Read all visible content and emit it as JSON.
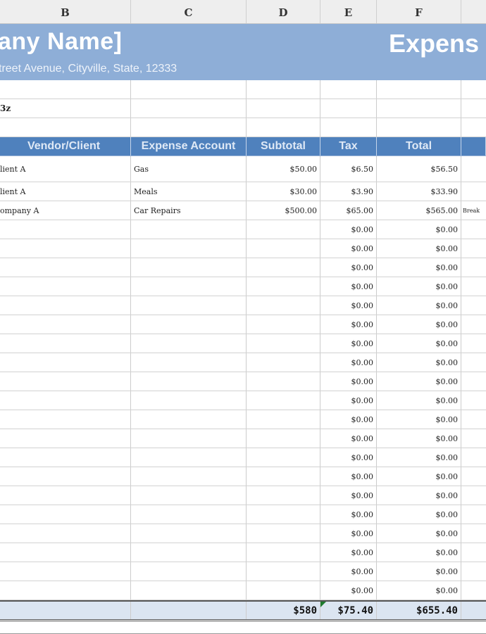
{
  "column_headers": [
    "B",
    "C",
    "D",
    "E",
    "F"
  ],
  "header_band": {
    "company_name": "any Name]",
    "address": "treet Avenue, Cityville, State, 12333",
    "document_title": "Expens"
  },
  "info_rows": {
    "row2_b": "3z"
  },
  "table": {
    "columns": [
      "Vendor/Client",
      "Expense Account",
      "Subtotal",
      "Tax",
      "Total",
      ""
    ],
    "rows": [
      {
        "vendor": "lient A",
        "account": "Gas",
        "subtotal": "$50.00",
        "tax": "$6.50",
        "total": "$56.50",
        "note": ""
      },
      {
        "vendor": "lient A",
        "account": "Meals",
        "subtotal": "$30.00",
        "tax": "$3.90",
        "total": "$33.90",
        "note": ""
      },
      {
        "vendor": "ompany A",
        "account": "Car Repairs",
        "subtotal": "$500.00",
        "tax": "$65.00",
        "total": "$565.00",
        "note": "Break"
      },
      {
        "vendor": "",
        "account": "",
        "subtotal": "",
        "tax": "$0.00",
        "total": "$0.00",
        "note": ""
      },
      {
        "vendor": "",
        "account": "",
        "subtotal": "",
        "tax": "$0.00",
        "total": "$0.00",
        "note": ""
      },
      {
        "vendor": "",
        "account": "",
        "subtotal": "",
        "tax": "$0.00",
        "total": "$0.00",
        "note": ""
      },
      {
        "vendor": "",
        "account": "",
        "subtotal": "",
        "tax": "$0.00",
        "total": "$0.00",
        "note": ""
      },
      {
        "vendor": "",
        "account": "",
        "subtotal": "",
        "tax": "$0.00",
        "total": "$0.00",
        "note": ""
      },
      {
        "vendor": "",
        "account": "",
        "subtotal": "",
        "tax": "$0.00",
        "total": "$0.00",
        "note": ""
      },
      {
        "vendor": "",
        "account": "",
        "subtotal": "",
        "tax": "$0.00",
        "total": "$0.00",
        "note": ""
      },
      {
        "vendor": "",
        "account": "",
        "subtotal": "",
        "tax": "$0.00",
        "total": "$0.00",
        "note": ""
      },
      {
        "vendor": "",
        "account": "",
        "subtotal": "",
        "tax": "$0.00",
        "total": "$0.00",
        "note": ""
      },
      {
        "vendor": "",
        "account": "",
        "subtotal": "",
        "tax": "$0.00",
        "total": "$0.00",
        "note": ""
      },
      {
        "vendor": "",
        "account": "",
        "subtotal": "",
        "tax": "$0.00",
        "total": "$0.00",
        "note": ""
      },
      {
        "vendor": "",
        "account": "",
        "subtotal": "",
        "tax": "$0.00",
        "total": "$0.00",
        "note": ""
      },
      {
        "vendor": "",
        "account": "",
        "subtotal": "",
        "tax": "$0.00",
        "total": "$0.00",
        "note": ""
      },
      {
        "vendor": "",
        "account": "",
        "subtotal": "",
        "tax": "$0.00",
        "total": "$0.00",
        "note": ""
      },
      {
        "vendor": "",
        "account": "",
        "subtotal": "",
        "tax": "$0.00",
        "total": "$0.00",
        "note": ""
      },
      {
        "vendor": "",
        "account": "",
        "subtotal": "",
        "tax": "$0.00",
        "total": "$0.00",
        "note": ""
      },
      {
        "vendor": "",
        "account": "",
        "subtotal": "",
        "tax": "$0.00",
        "total": "$0.00",
        "note": ""
      },
      {
        "vendor": "",
        "account": "",
        "subtotal": "",
        "tax": "$0.00",
        "total": "$0.00",
        "note": ""
      },
      {
        "vendor": "",
        "account": "",
        "subtotal": "",
        "tax": "$0.00",
        "total": "$0.00",
        "note": ""
      },
      {
        "vendor": "",
        "account": "",
        "subtotal": "",
        "tax": "$0.00",
        "total": "$0.00",
        "note": ""
      }
    ],
    "totals": {
      "subtotal": "$580",
      "tax": "$75.40",
      "total": "$655.40"
    }
  },
  "colors": {
    "header_band": "#8eaed7",
    "table_header": "#4f81bd",
    "totals_row": "#dbe5f1",
    "error_indicator": "#1e7b2e"
  }
}
